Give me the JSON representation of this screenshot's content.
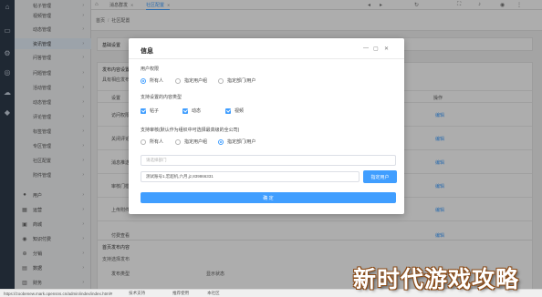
{
  "topbar": {
    "tabs": [
      {
        "label": "首页"
      },
      {
        "label": "消息群发"
      },
      {
        "label": "社区配置"
      }
    ]
  },
  "breadcrumb": {
    "items": [
      "首页",
      "社区配置"
    ]
  },
  "sidebar": {
    "items": [
      {
        "label": "帖子管理"
      },
      {
        "label": "视频管理"
      },
      {
        "label": "动态管理"
      },
      {
        "label": "资讯管理"
      },
      {
        "label": "问答管理"
      },
      {
        "label": "问题管理"
      },
      {
        "label": "活动管理"
      },
      {
        "label": "动态管理"
      },
      {
        "label": "评论管理"
      },
      {
        "label": "标签管理"
      },
      {
        "label": "专区管理"
      },
      {
        "label": "社区配置"
      },
      {
        "label": "附件管理"
      }
    ],
    "groups": [
      {
        "label": "用户"
      },
      {
        "label": "运营"
      },
      {
        "label": "商城"
      },
      {
        "label": "知识付费"
      },
      {
        "label": "分销"
      },
      {
        "label": "数据"
      },
      {
        "label": "财务"
      }
    ]
  },
  "page": {
    "card1_title": "基础设置",
    "section_publish": "发布内容设置",
    "section_sub": "具有相应发布权",
    "table_header": {
      "col1": "设置",
      "col_action": "操作"
    },
    "rows": [
      {
        "label": "访问权限",
        "action": "编辑"
      },
      {
        "label": "关闭评论",
        "action": "编辑"
      },
      {
        "label": "消息推送",
        "action": "编辑"
      },
      {
        "label": "审核门槛",
        "action": "编辑"
      },
      {
        "label": "上传附件",
        "action": "编辑"
      },
      {
        "label": "付费查看",
        "action": "编辑"
      }
    ],
    "card2_title": "首页发布内容",
    "card2_sub": "支持选择发布",
    "card2_header": {
      "col1": "发布类型",
      "col2": "显示状态"
    }
  },
  "modal": {
    "title": "信息",
    "perm_label": "用户权限",
    "perm_options": [
      "所有人",
      "指定用户组",
      "指定部门/用户"
    ],
    "perm_selected": 0,
    "types_label": "支持设置的内容类型",
    "types": [
      "帖子",
      "动态",
      "视频"
    ],
    "scope_label": "支持审核(默认作为组织中可选择最高级的全公司)",
    "scope_options": [
      "所有人",
      "指定用户组",
      "指定部门/用户"
    ],
    "scope_selected": 2,
    "dept_placeholder": "请选择部门",
    "user_value": "测试账号1,宏超机,六月,jz,839866331",
    "assign_button": "指定用户",
    "ok_button": "确 定"
  },
  "statusbar": {
    "url": "https://zoobenew.mark.opensns.cn/admin/index/index.html#",
    "text1": "技术支持",
    "text2": "推荐使用",
    "text3": "本社区"
  },
  "watermark": {
    "text": "新时代游戏攻略"
  }
}
